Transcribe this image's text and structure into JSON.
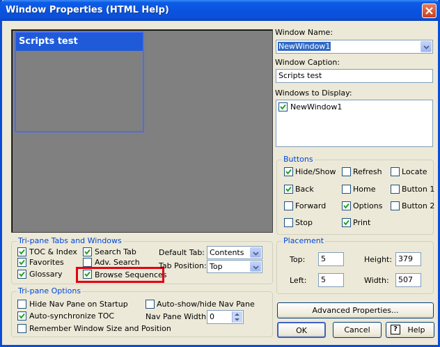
{
  "window": {
    "title": "Window Properties (HTML Help)"
  },
  "preview": {
    "caption": "Scripts test"
  },
  "window_name": {
    "label": "Window Name:",
    "value": "NewWindow1"
  },
  "window_caption": {
    "label": "Window Caption:",
    "value": "Scripts test"
  },
  "windows_to_display": {
    "label": "Windows to Display:",
    "items": [
      {
        "label": "NewWindow1",
        "checked": true
      }
    ]
  },
  "buttons_group": {
    "title": "Buttons",
    "items": [
      {
        "label": "Hide/Show",
        "checked": true
      },
      {
        "label": "Refresh",
        "checked": false
      },
      {
        "label": "Locate",
        "checked": false
      },
      {
        "label": "Back",
        "checked": true
      },
      {
        "label": "Home",
        "checked": false
      },
      {
        "label": "Button 1",
        "checked": false
      },
      {
        "label": "Forward",
        "checked": false
      },
      {
        "label": "Options",
        "checked": true
      },
      {
        "label": "Button 2",
        "checked": false
      },
      {
        "label": "Stop",
        "checked": false
      },
      {
        "label": "Print",
        "checked": true
      }
    ]
  },
  "tripane_tabs": {
    "title": "Tri-pane Tabs and Windows",
    "toc_index": {
      "label": "TOC & Index",
      "checked": true
    },
    "favorites": {
      "label": "Favorites",
      "checked": true
    },
    "glossary": {
      "label": "Glossary",
      "checked": true
    },
    "search_tab": {
      "label": "Search Tab",
      "checked": true
    },
    "adv_search": {
      "label": "Adv. Search",
      "checked": false
    },
    "browse_sequences": {
      "label": "Browse Sequences",
      "checked": true
    },
    "default_tab": {
      "label": "Default Tab:",
      "value": "Contents"
    },
    "tab_position": {
      "label": "Tab Position:",
      "value": "Top"
    }
  },
  "placement": {
    "title": "Placement",
    "top": {
      "label": "Top:",
      "value": "5"
    },
    "height": {
      "label": "Height:",
      "value": "379"
    },
    "left": {
      "label": "Left:",
      "value": "5"
    },
    "width": {
      "label": "Width:",
      "value": "507"
    }
  },
  "tripane_options": {
    "title": "Tri-pane Options",
    "hide_nav": {
      "label": "Hide Nav Pane on Startup",
      "checked": false
    },
    "auto_show": {
      "label": "Auto-show/hide Nav Pane",
      "checked": false
    },
    "auto_sync": {
      "label": "Auto-synchronize TOC",
      "checked": true
    },
    "nav_width": {
      "label": "Nav Pane Width:",
      "value": "0"
    },
    "remember": {
      "label": "Remember Window Size and Position",
      "checked": false
    }
  },
  "actions": {
    "advanced": "Advanced Properties...",
    "ok": "OK",
    "cancel": "Cancel",
    "help": "Help"
  }
}
